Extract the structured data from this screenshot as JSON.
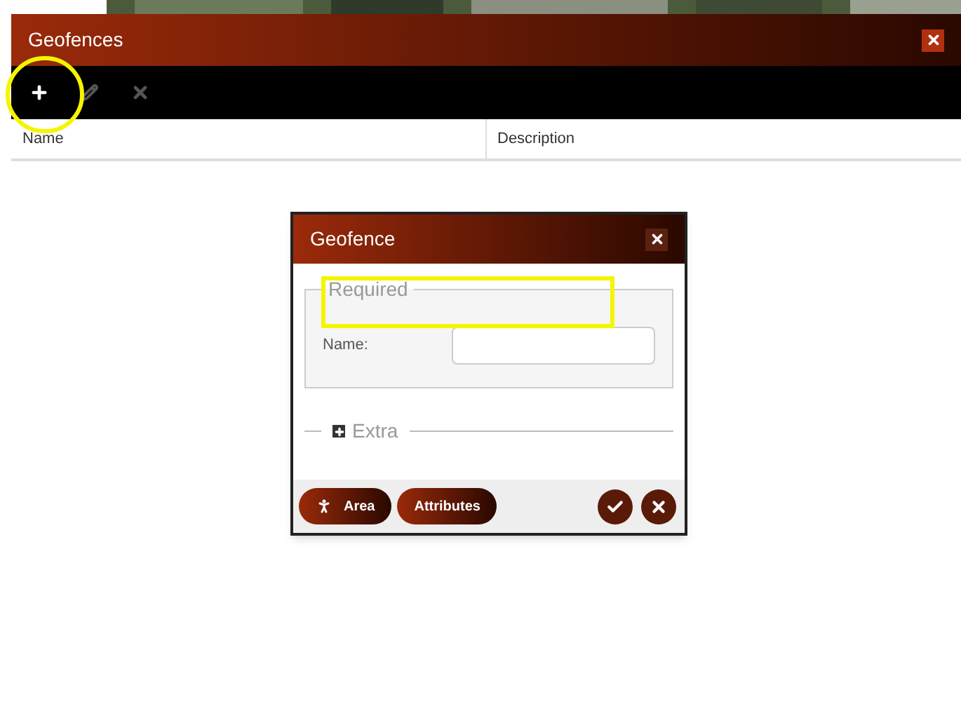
{
  "window": {
    "title": "Geofences"
  },
  "toolbar": [
    {
      "kind": "add",
      "disabled": false
    },
    {
      "kind": "edit",
      "disabled": true
    },
    {
      "kind": "delete",
      "disabled": true
    }
  ],
  "table": {
    "columns": [
      "Name",
      "Description"
    ]
  },
  "dialog": {
    "title": "Geofence",
    "required": {
      "legend": "Required",
      "fields": [
        {
          "label": "Name:"
        }
      ]
    },
    "extra": {
      "legend": "Extra",
      "expanded": false
    },
    "buttons": [
      {
        "kind": "area",
        "label": "Area"
      },
      {
        "kind": "attributes",
        "label": "Attributes"
      }
    ],
    "actions": [
      {
        "kind": "save"
      },
      {
        "kind": "cancel"
      }
    ]
  }
}
